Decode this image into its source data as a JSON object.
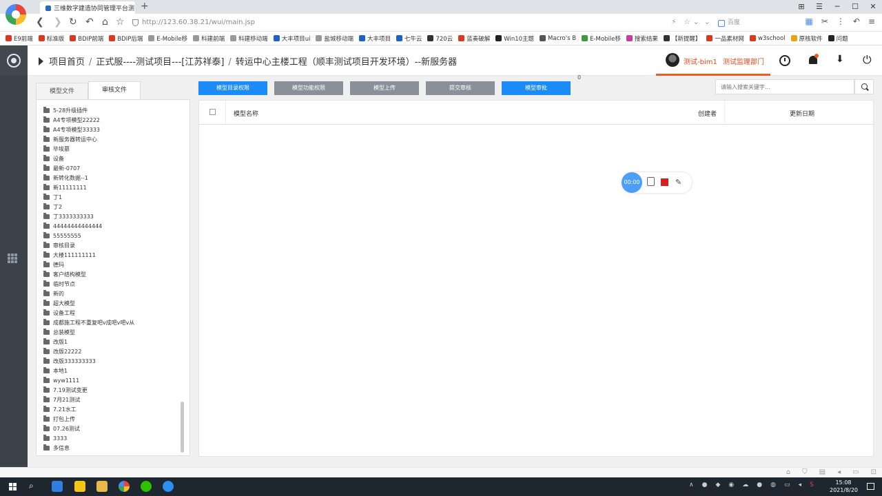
{
  "browser": {
    "tab_title": "三维数字建造协同管理平台​测",
    "new_tab": "+",
    "url": "http://123.60.38.21/wui/main.jsp",
    "search_placeholder": "百度",
    "window_buttons": [
      "⊞",
      "☰",
      "─",
      "☐",
      "✕"
    ],
    "tools": [
      "✂",
      "⋮",
      "↶",
      "≡"
    ],
    "bookmarks": [
      {
        "label": "E9前端",
        "color": "#d9391f"
      },
      {
        "label": "标准版",
        "color": "#d9391f"
      },
      {
        "label": "BDIP前端",
        "color": "#d9391f"
      },
      {
        "label": "BDIP后端",
        "color": "#d9391f"
      },
      {
        "label": "E-Mobile移",
        "color": "#999999"
      },
      {
        "label": "科建前端",
        "color": "#999999"
      },
      {
        "label": "科建移动端",
        "color": "#999999"
      },
      {
        "label": "大丰项目ui",
        "color": "#1e62c7"
      },
      {
        "label": "盐城移动端",
        "color": "#999999"
      },
      {
        "label": "大丰项目",
        "color": "#1e62c7"
      },
      {
        "label": "七牛云",
        "color": "#1e62c7"
      },
      {
        "label": "720云",
        "color": "#333333"
      },
      {
        "label": "蓝奏破解",
        "color": "#d9391f"
      },
      {
        "label": "Win10主题",
        "color": "#222222"
      },
      {
        "label": "Macro's B",
        "color": "#555555"
      },
      {
        "label": "E-Mobile移",
        "color": "#3c9b3c"
      },
      {
        "label": "搜索结果",
        "color": "#c43f9f"
      },
      {
        "label": "【新提醒】",
        "color": "#333333"
      },
      {
        "label": "一品素材网",
        "color": "#d9391f"
      },
      {
        "label": "w3school",
        "color": "#d9391f"
      },
      {
        "label": "原核软件",
        "color": "#e8a317"
      },
      {
        "label": "问题",
        "color": "#222222"
      }
    ]
  },
  "header": {
    "breadcrumb": [
      "项目首页",
      "正式服----测试项目---[江苏祥泰]",
      "转运中心主楼工程（顺丰测试项目开发环境）--新服务器"
    ],
    "user_name": "测试-bim1",
    "user_dept": "测试监理部门"
  },
  "files": {
    "tabs": [
      "模型文件",
      "审核文件"
    ],
    "folders": [
      "5-28升级插件",
      "A4专项模型22222",
      "A4专项模型33333",
      "新服务器转运中心",
      "毕埃慕",
      "设备",
      "最新-0707",
      "新转化数据--1",
      "新11111111",
      "丁1",
      "丁2",
      "丁3333333333",
      "44444444444444",
      "55555555",
      "审核目录",
      "大楼111111111",
      "德玛",
      "客户结构模型",
      "临时节点",
      "新的",
      "超大模型",
      "设备工程",
      "成都施工程不重复吧v成吧v吧v从",
      "总装模型",
      "改版1",
      "改版22222",
      "改版333333333",
      "本地1",
      "wyw1111",
      "7.19测试变更",
      "7月21测试",
      "7.21水工",
      "打包上传",
      "07.26测试",
      "3333",
      "多信息"
    ]
  },
  "toolbar": {
    "buttons": [
      "模型目录权限",
      "模型功能权限",
      "模型上传",
      "提交审核",
      "模型审批"
    ],
    "count": "0",
    "search_placeholder": "请输入搜索关键字..."
  },
  "table": {
    "columns": [
      "模型名称",
      "创建者",
      "更新日期"
    ]
  },
  "recorder": {
    "time": "00:00"
  },
  "taskbar": {
    "time": "15:08",
    "date": "2021/8/20"
  }
}
